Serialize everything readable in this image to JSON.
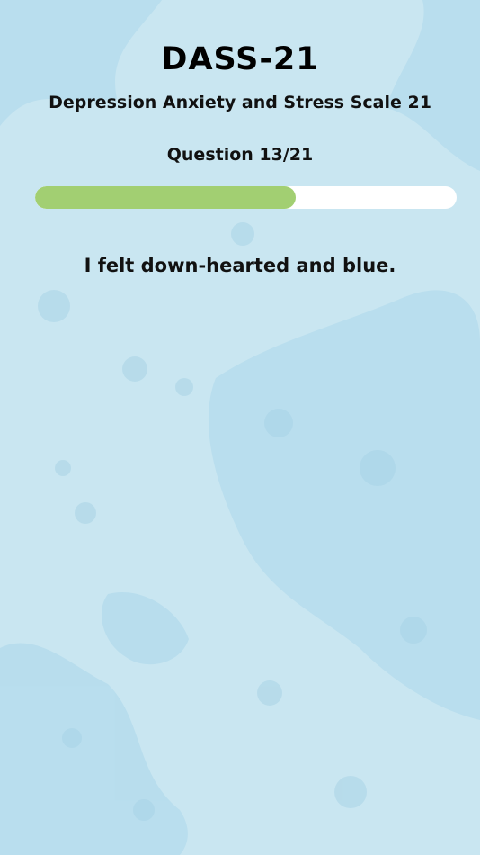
{
  "header": {
    "title": "DASS-21",
    "subtitle": "Depression Anxiety and Stress Scale 21"
  },
  "progress": {
    "label": "Question 13/21",
    "current": 13,
    "total": 21,
    "fill_color": "#a2cf72",
    "track_color": "#ffffff"
  },
  "question": {
    "text": "I felt down-hearted and blue."
  },
  "theme": {
    "background": "#c9e6f1",
    "splash": "#a9d3e6"
  }
}
